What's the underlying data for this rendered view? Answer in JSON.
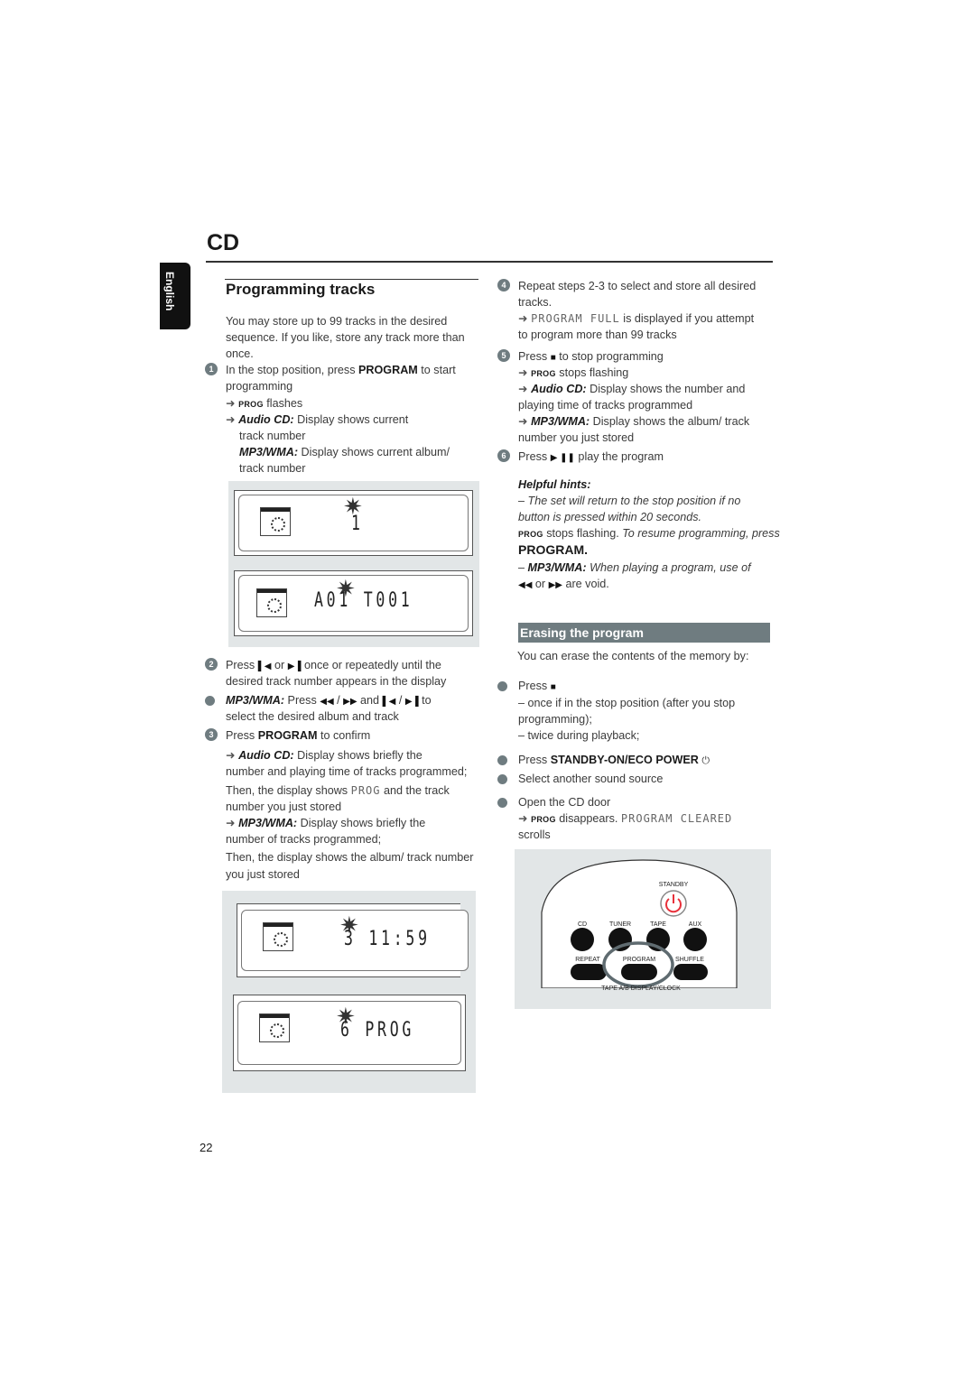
{
  "header": {
    "section": "CD",
    "language_tab": "English",
    "page_number": "22"
  },
  "left": {
    "title": "Programming tracks",
    "intro": [
      "You may store up to 99 tracks in the desired",
      "sequence. If you like, store any track more than",
      "once."
    ],
    "step1": {
      "num": "1",
      "pre": "In the stop position, press ",
      "bold": "PROGRAM",
      "post": " to start",
      "line2": "programming",
      "r1_prog": "PROG",
      "r1_text": " flashes",
      "r2_label": "Audio CD:",
      "r2_text": " Display shows current",
      "r2_line2": "track number",
      "r3_label": "MP3/WMA:",
      "r3_text": " Display shows current album/",
      "r3_line2": "track number"
    },
    "fig1": {
      "display1": "1",
      "display2": "A01  T001"
    },
    "step2": {
      "num": "2",
      "press": "Press ",
      "or": " or ",
      "text": " once or repeatedly until the",
      "line2": "desired track number appears in the display"
    },
    "bullet": {
      "label": "MP3/WMA:",
      "press": " Press ",
      "slash": " / ",
      "and": " and ",
      "to": " to",
      "line2": "select the desired album and track"
    },
    "step3": {
      "num": "3",
      "pre": "Press ",
      "bold": "PROGRAM",
      "post": " to confirm",
      "a_label": "Audio CD:",
      "a_text": " Display shows briefly the",
      "a_line2": "number and playing time of tracks programmed;",
      "then1_pre": "Then, the display shows ",
      "then1_lcd": "PROG",
      "then1_post": "  and  the track",
      "then1_line2": "number you just stored",
      "m_label": "MP3/WMA:",
      "m_text": " Display shows briefly the",
      "m_line2": "number of tracks programmed;",
      "then2": "Then, the display shows the album/ track number",
      "then2_line2": "you just stored"
    },
    "fig2": {
      "display1": "3  11:59",
      "display2": "6 PROG"
    }
  },
  "right": {
    "step4": {
      "num": "4",
      "text": "Repeat steps 2-3 to select and store all desired",
      "line2": "tracks.",
      "lcd": "PROGRAM FULL",
      "r_text": " is displayed if you attempt",
      "r_line2": "to program more than 99 tracks"
    },
    "step5": {
      "num": "5",
      "press": "Press ",
      "text": " to stop programming",
      "prog": "PROG",
      "prog_text": " stops flashing",
      "a_label": "Audio CD:",
      "a_text": " Display shows  the number and",
      "a_line2": "playing time of tracks programmed",
      "m_label": "MP3/WMA:",
      "m_text": " Display shows the album/ track",
      "m_line2": "number you just stored"
    },
    "step6": {
      "num": "6",
      "press": "Press ",
      "text": " play the program"
    },
    "hints": {
      "title": "Helpful hints:",
      "h1": "–  The set will return to the stop position if no",
      "h1_line2": "button is pressed within 20 seconds.",
      "prog": "PROG",
      "h2_text": " stops flashing. ",
      "h2_it": "To resume programming, press",
      "h2_bold": "PROGRAM.",
      "h3_dash": "– ",
      "h3_label": "MP3/WMA:",
      "h3_text": "  When playing a program, use of",
      "h3_or": " or ",
      "h3_void": "  are void."
    },
    "erase": {
      "title": "Erasing the program",
      "intro": "You can erase the contents of the memory by:",
      "b1": "Press ",
      "b1_s1": "–  once if in the stop position (after you stop",
      "b1_s1_line2": "programming);",
      "b1_s2": "–  twice during playback;",
      "b2_pre": "Press ",
      "b2_bold": "STANDBY-ON/ECO POWER",
      "b3": "Select another sound source",
      "b4": "Open the CD door",
      "b4_prog": "PROG",
      "b4_text": " disappears.  ",
      "b4_lcd": "PROGRAM CLEARED",
      "b4_line2": "scrolls"
    },
    "remote": {
      "standby": "STANDBY",
      "cd": "CD",
      "tuner": "TUNER",
      "tape": "TAPE",
      "aux": "AUX",
      "repeat": "REPEAT",
      "program": "PROGRAM",
      "shuffle": "SHUFFLE",
      "bottom": "TAPE A/B     DISPLAY/CLOCK"
    }
  },
  "colors": {
    "accent_bar": "#6f7c80",
    "figure_bg": "#e2e6e7",
    "standby_red": "#e8303a"
  }
}
